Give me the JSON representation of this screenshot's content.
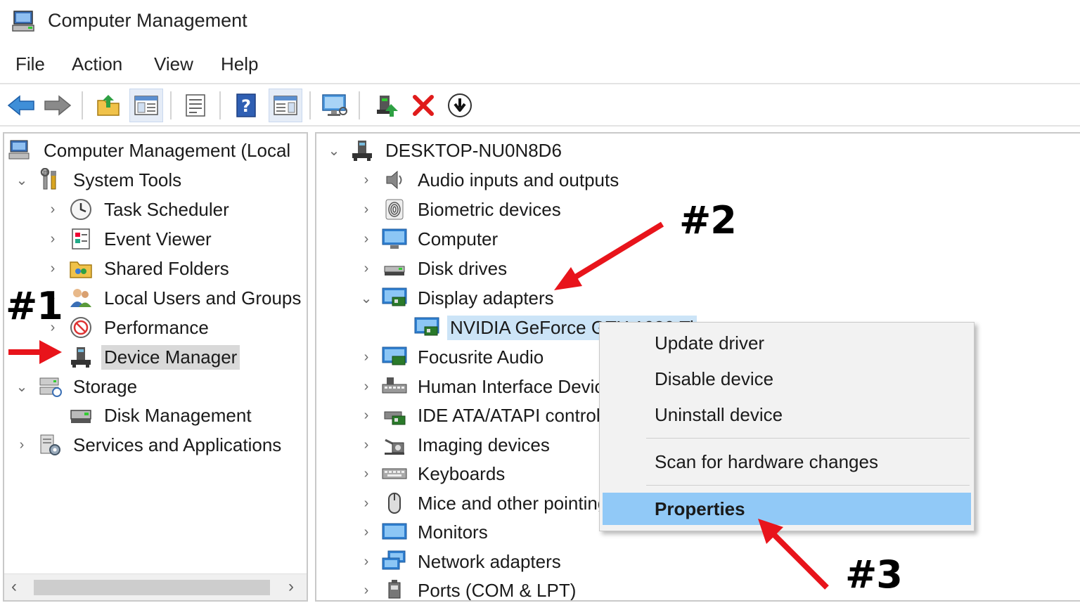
{
  "window": {
    "title": "Computer Management"
  },
  "menu": [
    "File",
    "Action",
    "View",
    "Help"
  ],
  "toolbar": {
    "buttons": [
      "back-icon",
      "forward-icon",
      "up-folder-icon",
      "show-tree-icon",
      "properties-icon",
      "help-icon",
      "show-action-pane-icon",
      "monitor-icon",
      "update-driver-icon",
      "uninstall-icon",
      "download-icon"
    ]
  },
  "left_tree": {
    "root": "Computer Management (Local",
    "system_tools": "System Tools",
    "task_scheduler": "Task Scheduler",
    "event_viewer": "Event Viewer",
    "shared_folders": "Shared Folders",
    "local_users": "Local Users and Groups",
    "performance": "Performance",
    "device_manager": "Device Manager",
    "storage": "Storage",
    "disk_management": "Disk Management",
    "services": "Services and Applications"
  },
  "device_tree": {
    "root": "DESKTOP-NU0N8D6",
    "items": [
      "Audio inputs and outputs",
      "Biometric devices",
      "Computer",
      "Disk drives",
      "Display adapters",
      "NVIDIA GeForce GTX 1080 Ti",
      "Focusrite Audio",
      "Human Interface Devices",
      "IDE ATA/ATAPI controllers",
      "Imaging devices",
      "Keyboards",
      "Mice and other pointing devices",
      "Monitors",
      "Network adapters",
      "Ports (COM & LPT)"
    ]
  },
  "context_menu": {
    "update": "Update driver",
    "disable": "Disable device",
    "uninstall": "Uninstall device",
    "scan": "Scan for hardware changes",
    "properties": "Properties"
  },
  "annotations": {
    "a1": "#1",
    "a2": "#2",
    "a3": "#3"
  },
  "colors": {
    "selection": "#cce4f7",
    "menu_highlight": "#91c9f7",
    "arrow": "#e8141b"
  }
}
